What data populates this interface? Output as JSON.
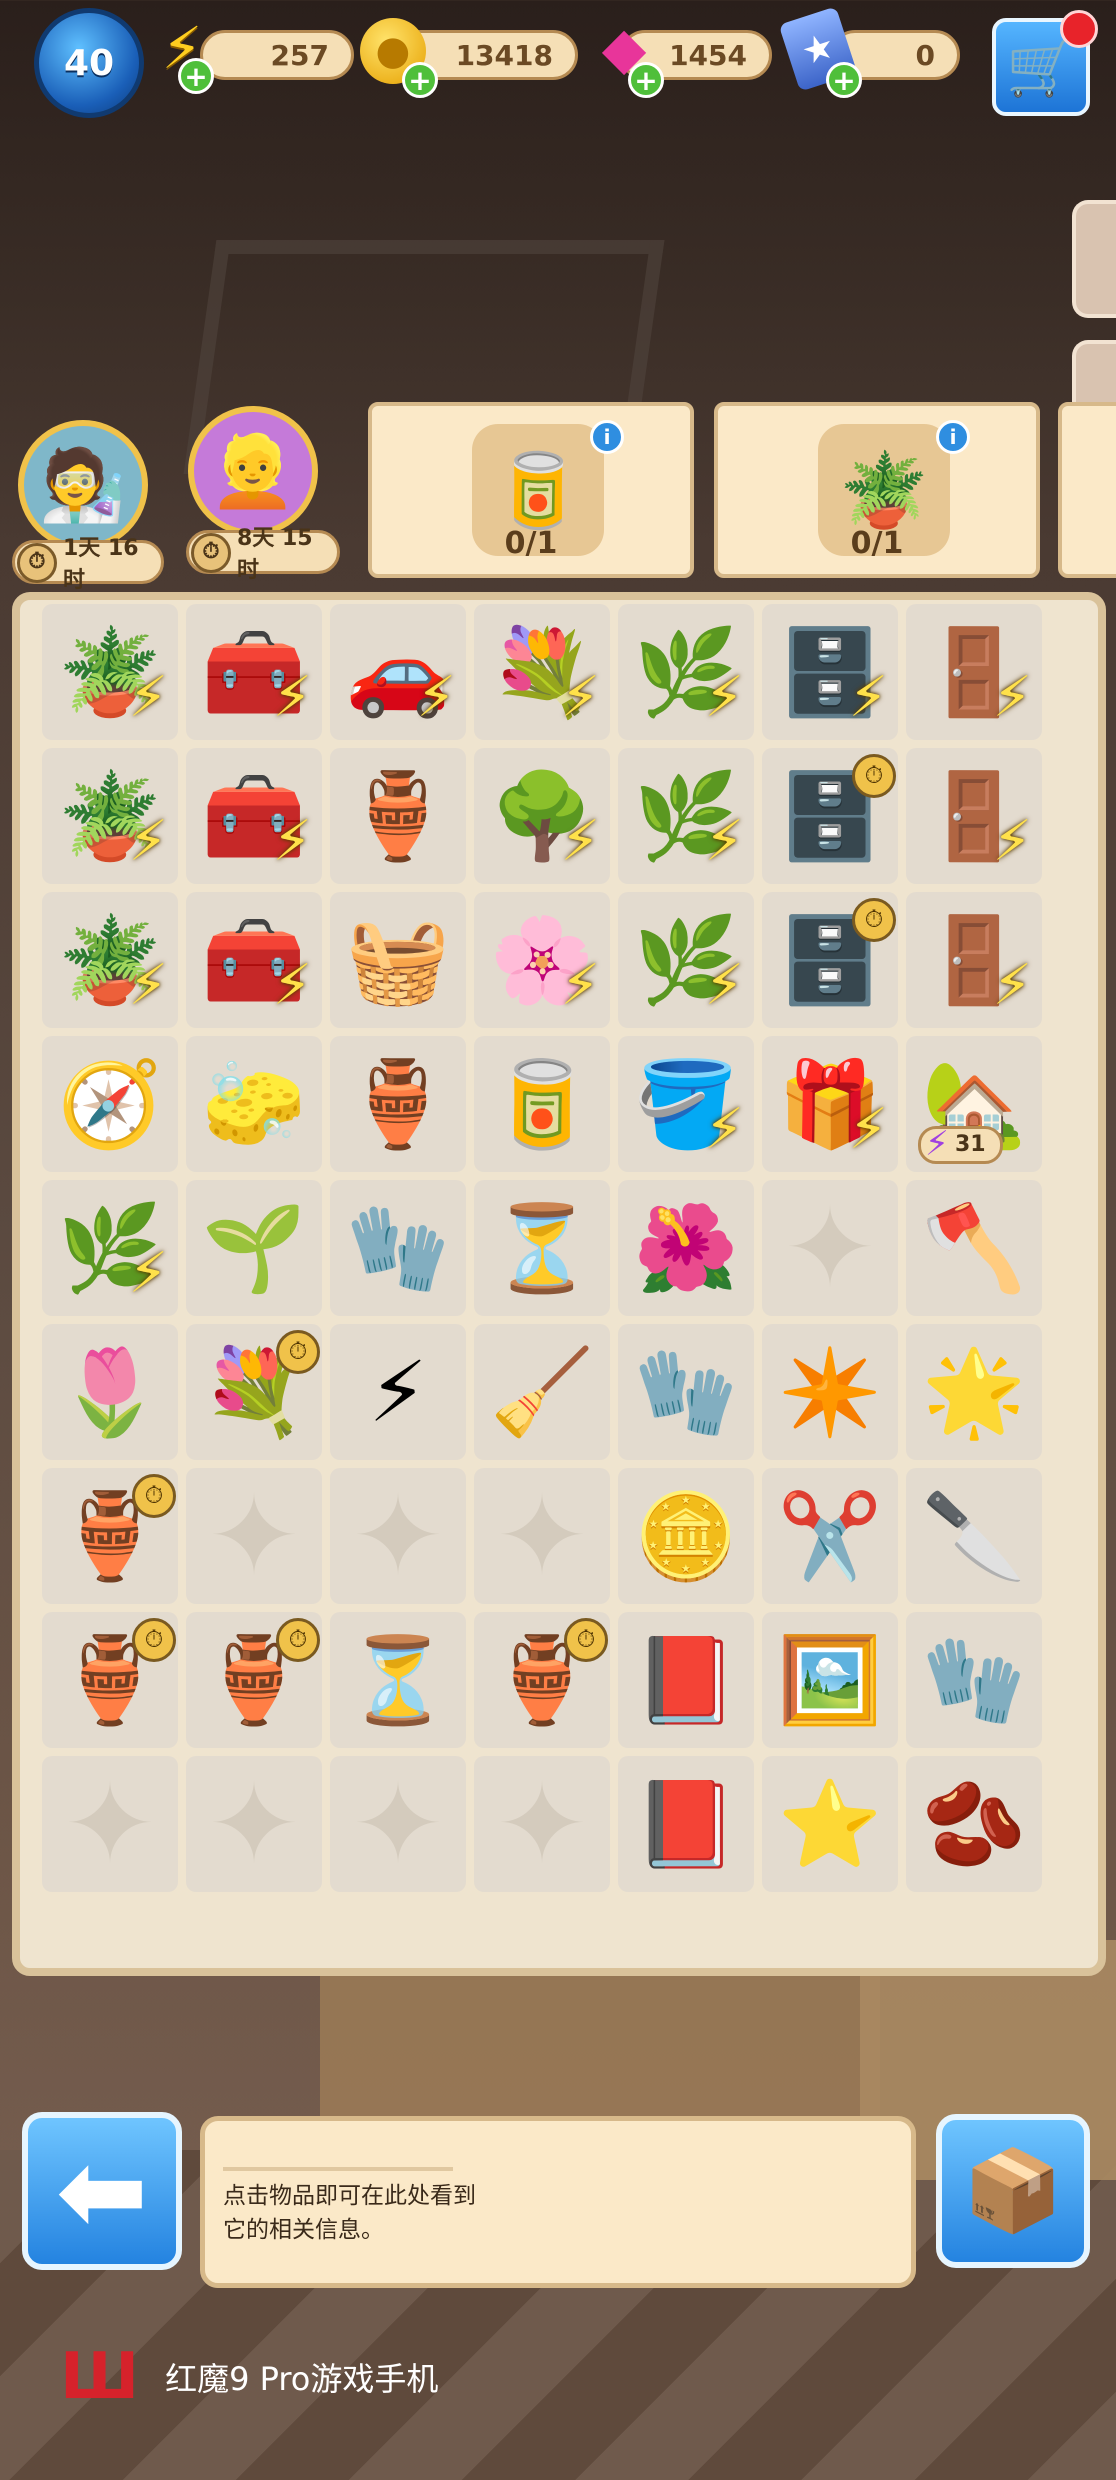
{
  "topbar": {
    "level": "40",
    "energy": "257",
    "coins": "13418",
    "gems": "1454",
    "cards": "0"
  },
  "characters": [
    {
      "timer": "1天 16时"
    },
    {
      "timer": "8天 15时"
    }
  ],
  "orders": [
    {
      "count": "0/1"
    },
    {
      "count": "0/1"
    }
  ],
  "board": {
    "badge_value": "31",
    "cells": [
      [
        "🪴",
        "🧰",
        "🚗",
        "💐",
        "🌿",
        "🗄️",
        "🚪"
      ],
      [
        "🪴",
        "🧰",
        "🏺",
        "🌳",
        "🌿",
        "🗄️",
        "🚪"
      ],
      [
        "🪴",
        "🧰",
        "🧺",
        "🌸",
        "🌿",
        "🗄️",
        "🚪"
      ],
      [
        "🧭",
        "🧽",
        "🏺",
        "🥫",
        "🪣",
        "🎁",
        "🏡"
      ],
      [
        "🌿",
        "🌱",
        "🧤",
        "⏳",
        "🌺",
        "",
        "🪓"
      ],
      [
        "🌷",
        "💐",
        "⚡",
        "🧹",
        "🧤",
        "✴️",
        "🌟"
      ],
      [
        "🏺",
        "",
        "",
        "",
        "🪙",
        "✂️",
        "🔪"
      ],
      [
        "🏺",
        "🏺",
        "⏳",
        "🏺",
        "📕",
        "🖼️",
        "🧤"
      ],
      [
        "",
        "",
        "",
        "",
        "📕",
        "⭐",
        "🫘"
      ]
    ]
  },
  "info_panel": {
    "text": "点击物品即可在此处看到\n它的相关信息。"
  },
  "brand": {
    "text": "红魔9 Pro游戏手机"
  }
}
